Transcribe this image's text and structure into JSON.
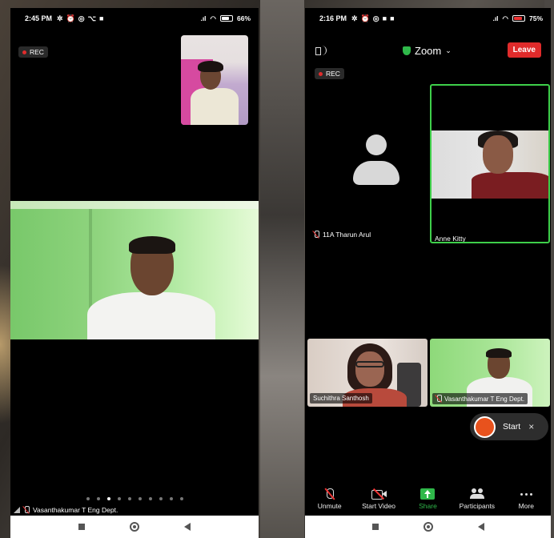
{
  "left_phone": {
    "status": {
      "time": "2:45 PM",
      "battery": "66"
    },
    "rec_label": "REC",
    "page_dots_count": 10,
    "active_dot": 2,
    "speaker_name": "Vasanthakumar T Eng Dept."
  },
  "right_phone": {
    "status": {
      "time": "2:16 PM",
      "battery": "75"
    },
    "zoom_title": "Zoom",
    "leave_label": "Leave",
    "rec_label": "REC",
    "participants": {
      "tharun": "11A Tharun Arul",
      "anne": "Anne Kitty",
      "suchithra": "Suchithra Santhosh",
      "vasanth": "Vasanthakumar T Eng Dept."
    },
    "record": {
      "label": "Start",
      "close": "×"
    },
    "toolbar": {
      "unmute": "Unmute",
      "start_video": "Start Video",
      "share": "Share",
      "participants": "Participants",
      "more": "More"
    }
  },
  "colors": {
    "leave_red": "#e02b2b",
    "active_speaker_green": "#3ecf4a",
    "share_green": "#2fb84a",
    "record_orange": "#e8521d"
  }
}
